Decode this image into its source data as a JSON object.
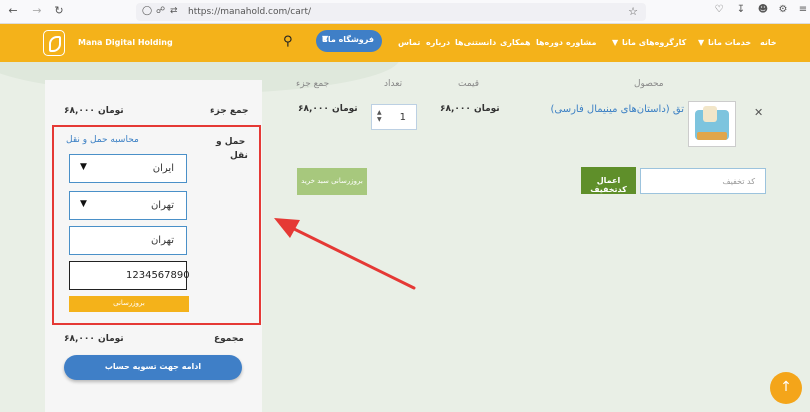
{
  "browser": {
    "url": "https://manahold.com/cart/"
  },
  "header": {
    "brand": "Mana Digital Holding",
    "shop_button": "فروشگاه مانا",
    "menu": [
      "خانه",
      "خدمات مانا",
      "کارگروه‌های مانا",
      "مشاوره",
      "دوره‌ها",
      "همکاری",
      "دانستنی‌ها",
      "درباره",
      "تماس"
    ]
  },
  "cart": {
    "headers": {
      "product": "محصول",
      "price": "قیمت",
      "qty": "تعداد",
      "subtotal": "جمع جزء"
    },
    "item": {
      "name": "تق (داستان‌های مینیمال فارسی)",
      "price": "۶۸,۰۰۰ تومان",
      "qty": "1",
      "subtotal": "۶۸,۰۰۰ تومان"
    },
    "coupon_placeholder": "کد تخفیف",
    "apply_coupon": "اعمال کدتخفیف",
    "update_cart": "بروزرسانی سبد خرید"
  },
  "totals": {
    "subtotal_label": "جمع جزء",
    "subtotal_value": "۶۸,۰۰۰ تومان",
    "shipping_label_1": "حمل و",
    "shipping_label_2": "نقل",
    "calc_shipping": "محاسبه حمل و نقل",
    "country": "ایران",
    "state": "تهران",
    "city": "تهران",
    "postcode": "1234567890",
    "update": "بروزرسانی",
    "total_label": "مجموع",
    "total_value": "۶۸,۰۰۰ تومان",
    "checkout": "ادامه جهت تسویه حساب"
  },
  "colors": {
    "header": "#f4b21a",
    "primary": "#3f7fc7",
    "annotation": "#e53935"
  }
}
